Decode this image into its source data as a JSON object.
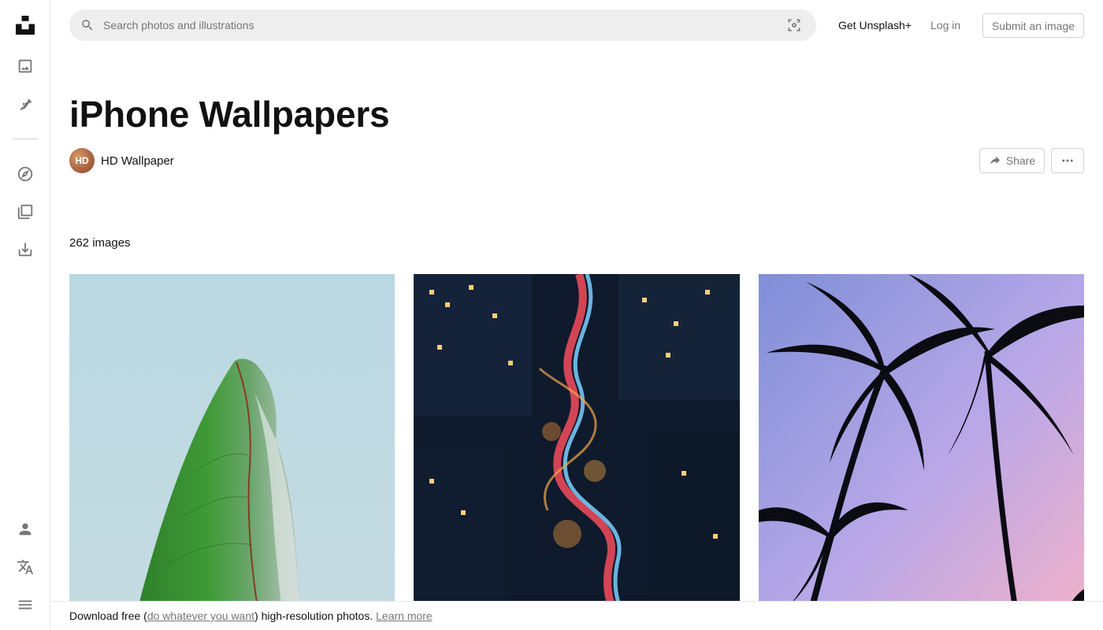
{
  "header": {
    "search_placeholder": "Search photos and illustrations",
    "get_plus": "Get Unsplash+",
    "login": "Log in",
    "submit": "Submit an image"
  },
  "sidebar": {
    "items": [
      {
        "icon": "unsplash-logo-icon"
      },
      {
        "icon": "photos-icon"
      },
      {
        "icon": "illustrations-pen-icon"
      },
      {
        "icon": "explore-compass-icon"
      },
      {
        "icon": "collections-icon"
      },
      {
        "icon": "download-icon"
      },
      {
        "icon": "user-icon"
      },
      {
        "icon": "language-icon"
      },
      {
        "icon": "menu-icon"
      }
    ]
  },
  "collection": {
    "title": "iPhone Wallpapers",
    "author_initials": "HD",
    "author": "HD Wallpaper",
    "share": "Share",
    "count": "262 images"
  },
  "photos": [
    {
      "subject": "green banana leaf against pale blue sky"
    },
    {
      "subject": "winding city street with car light trails at night"
    },
    {
      "subject": "palm tree silhouettes against pink and purple sky"
    }
  ],
  "banner": {
    "prefix": "Download free (",
    "link": "do whatever you want",
    "middle": ") high-resolution photos. ",
    "learn_more": "Learn more"
  },
  "colors": {
    "text": "#111111",
    "muted": "#767676",
    "search_bg": "#eeeeee",
    "border": "#d1d1d1"
  }
}
